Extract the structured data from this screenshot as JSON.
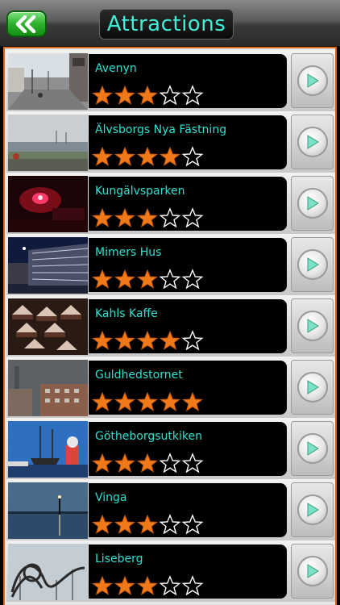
{
  "header": {
    "title": "Attractions",
    "back_icon": "double-chevron-left-icon"
  },
  "colors": {
    "accent": "#3ff0d8",
    "star_filled": "#f07a1a",
    "frame": "#d86a1c",
    "back_button": "#2fb12f"
  },
  "attractions": [
    {
      "name": "Avenyn",
      "rating": 3,
      "max_rating": 5
    },
    {
      "name": "Älvsborgs Nya Fästning",
      "rating": 4,
      "max_rating": 5
    },
    {
      "name": "Kungälvsparken",
      "rating": 3,
      "max_rating": 5
    },
    {
      "name": "Mimers Hus",
      "rating": 3,
      "max_rating": 5
    },
    {
      "name": "Kahls Kaffe",
      "rating": 4,
      "max_rating": 5
    },
    {
      "name": "Guldhedstornet",
      "rating": 5,
      "max_rating": 5
    },
    {
      "name": "Götheborgsutkiken",
      "rating": 3,
      "max_rating": 5
    },
    {
      "name": "Vinga",
      "rating": 3,
      "max_rating": 5
    },
    {
      "name": "Liseberg",
      "rating": 3,
      "max_rating": 5
    }
  ]
}
